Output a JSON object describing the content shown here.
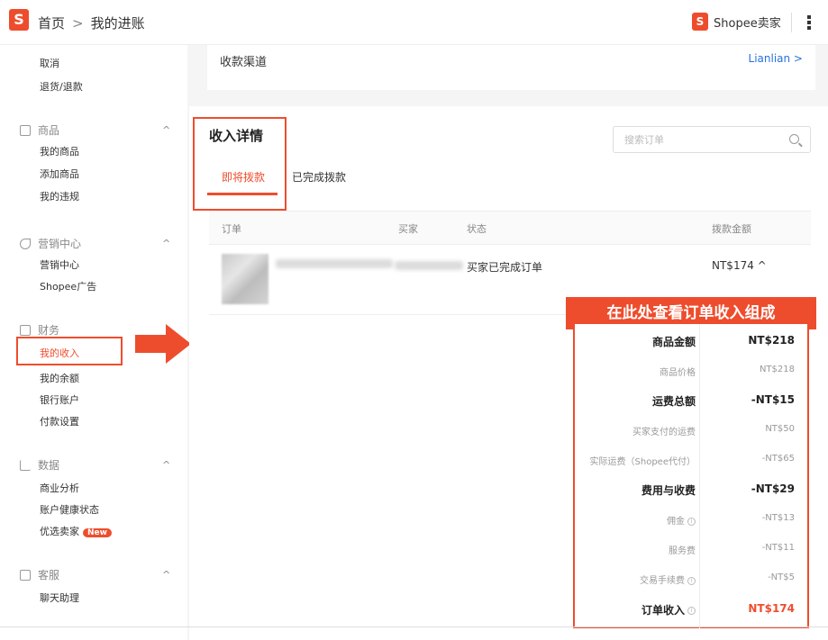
{
  "topbar": {
    "logo_letter": "S",
    "breadcrumb_home": "首页",
    "breadcrumb_sep": ">",
    "breadcrumb_current": "我的进账",
    "seller_logo_letter": "S",
    "seller_label": "Shopee卖家"
  },
  "sidebar": {
    "order_items": [
      "取消",
      "退货/退款"
    ],
    "product_head": "商品",
    "product_items": [
      "我的商品",
      "添加商品",
      "我的违规"
    ],
    "marketing_head": "营销中心",
    "marketing_items": [
      "营销中心",
      "Shopee广告"
    ],
    "finance_head": "财务",
    "finance_items": [
      "我的收入",
      "我的余额",
      "银行账户",
      "付款设置"
    ],
    "data_head": "数据",
    "data_items": [
      "商业分析",
      "账户健康状态",
      "优选卖家"
    ],
    "new_badge": "New",
    "service_head": "客服",
    "service_items": [
      "聊天助理"
    ],
    "chevron": "^"
  },
  "channel": {
    "label": "收款渠道",
    "value": "Lianlian >"
  },
  "income": {
    "title": "收入详情",
    "search_placeholder": "搜索订单",
    "tab_upcoming": "即将拨款",
    "tab_done": "已完成拨款"
  },
  "table": {
    "col_order": "订单",
    "col_buyer": "买家",
    "col_status": "状态",
    "col_amount": "拨款金额",
    "row_status": "买家已完成订单",
    "row_amount": "NT$174 ^"
  },
  "callout": "在此处查看订单收入组成",
  "breakdown": [
    {
      "label": "商品金额",
      "value": "NT$218",
      "bold": true
    },
    {
      "label": "商品价格",
      "value": "NT$218",
      "bold": false
    },
    {
      "label": "运费总额",
      "value": "-NT$15",
      "bold": true
    },
    {
      "label": "买家支付的运费",
      "value": "NT$50",
      "bold": false
    },
    {
      "label": "实际运费（Shopee代付）",
      "value": "-NT$65",
      "bold": false
    },
    {
      "label": "费用与收费",
      "value": "-NT$29",
      "bold": true
    },
    {
      "label": "佣金",
      "value": "-NT$13",
      "bold": false
    },
    {
      "label": "服务费",
      "value": "-NT$11",
      "bold": false
    },
    {
      "label": "交易手续费",
      "value": "-NT$5",
      "bold": false
    },
    {
      "label": "订单收入",
      "value": "NT$174",
      "bold": true
    }
  ],
  "colors": {
    "accent": "#ee4d2d",
    "link": "#2673dd"
  }
}
